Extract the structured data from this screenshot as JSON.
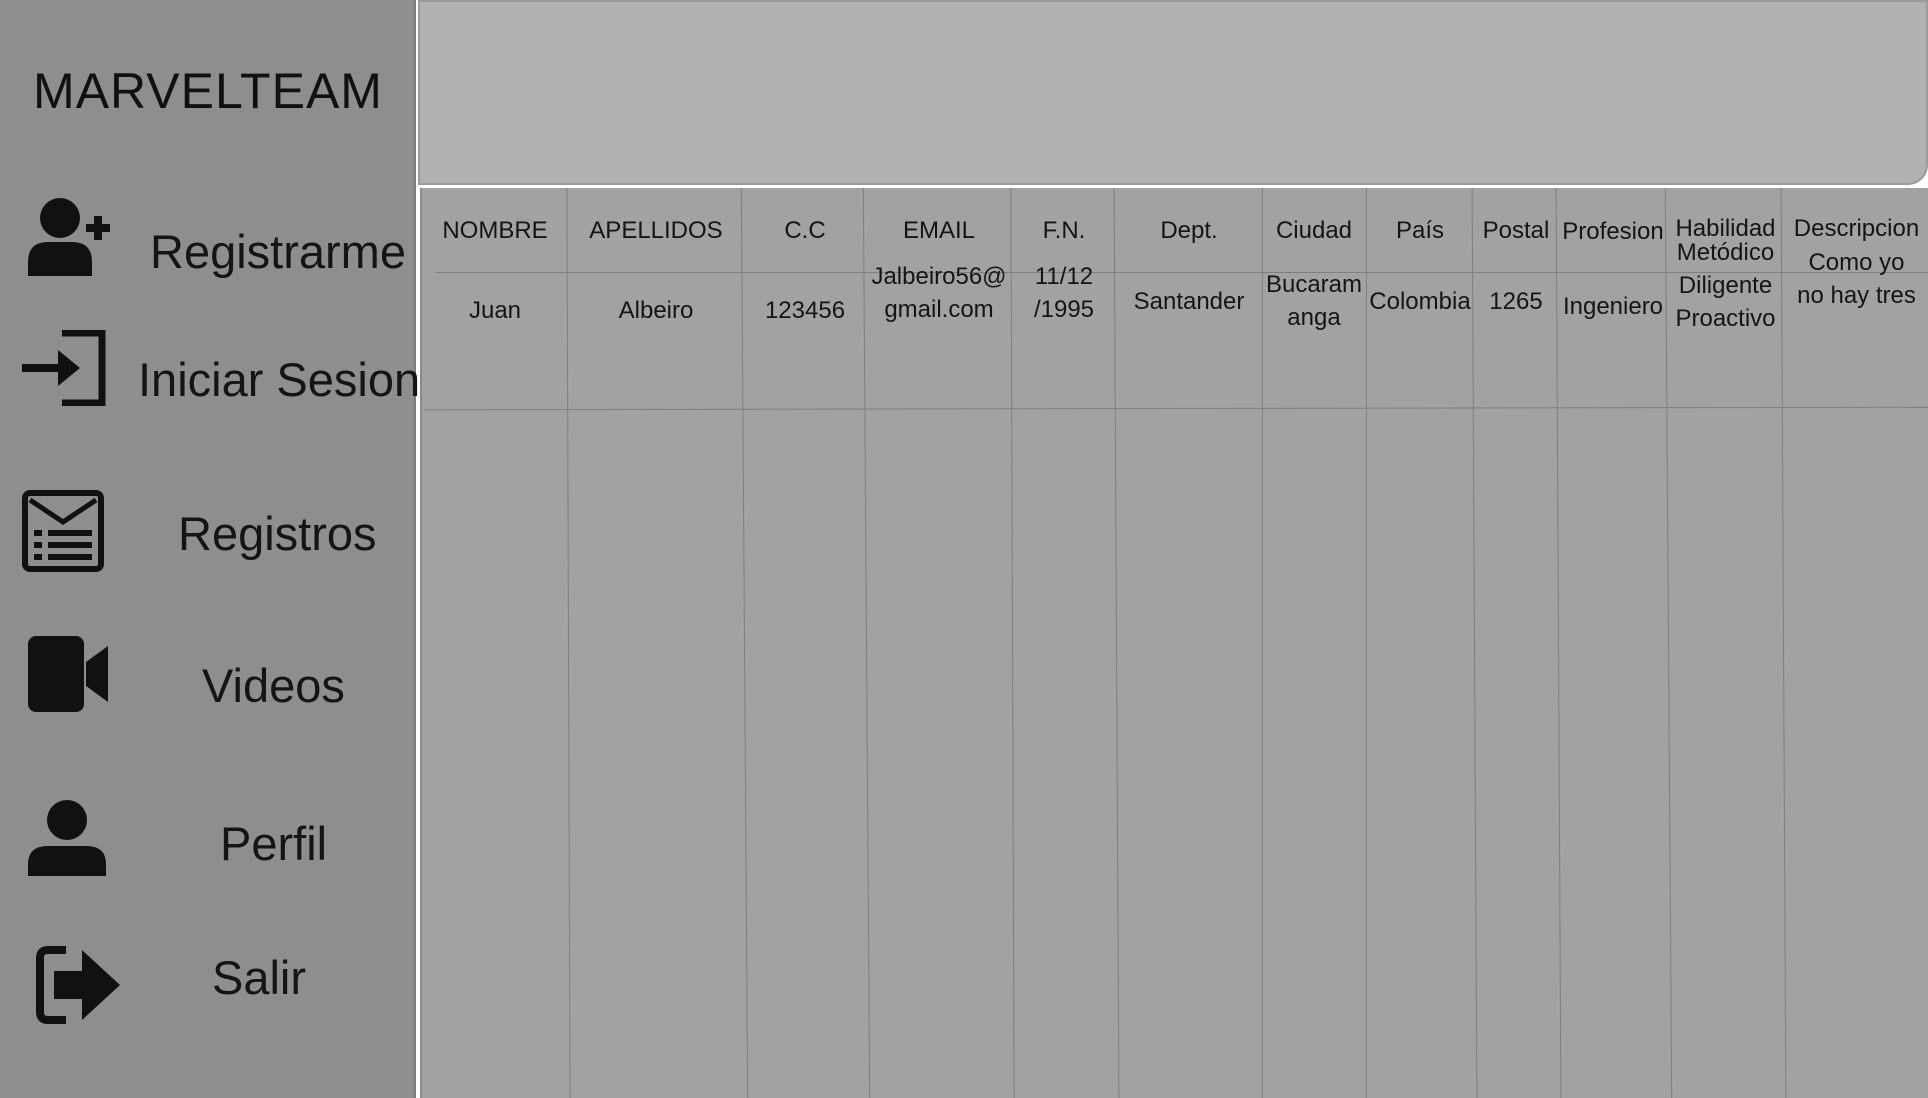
{
  "app": {
    "brand": "MARVELTEAM"
  },
  "sidebar": {
    "items": [
      {
        "label": "Registrarme",
        "icon": "user-plus-icon"
      },
      {
        "label": "Iniciar Sesion",
        "icon": "sign-in-icon"
      },
      {
        "label": "Registros",
        "icon": "list-document-icon"
      },
      {
        "label": "Videos",
        "icon": "video-camera-icon"
      },
      {
        "label": "Perfil",
        "icon": "user-icon"
      },
      {
        "label": "Salir",
        "icon": "sign-out-icon"
      }
    ]
  },
  "table": {
    "columns": [
      "NOMBRE",
      "APELLIDOS",
      "C.C",
      "EMAIL",
      "F.N.",
      "Dept.",
      "Ciudad",
      "País",
      "Postal",
      "Profesion",
      "Habilidad",
      "Descripcion"
    ],
    "rows": [
      {
        "cells": [
          [
            "Juan"
          ],
          [
            "Albeiro"
          ],
          [
            "123456"
          ],
          [
            "Jalbeiro56@",
            "gmail.com"
          ],
          [
            "11/12",
            "/1995"
          ],
          [
            "Santander"
          ],
          [
            "Bucaram",
            "anga"
          ],
          [
            "Colombia"
          ],
          [
            "1265"
          ],
          [
            "Ingeniero"
          ],
          [
            "Metódico",
            "Diligente",
            "Proactivo"
          ],
          [
            "Como yo",
            "no hay tres"
          ]
        ]
      }
    ]
  }
}
